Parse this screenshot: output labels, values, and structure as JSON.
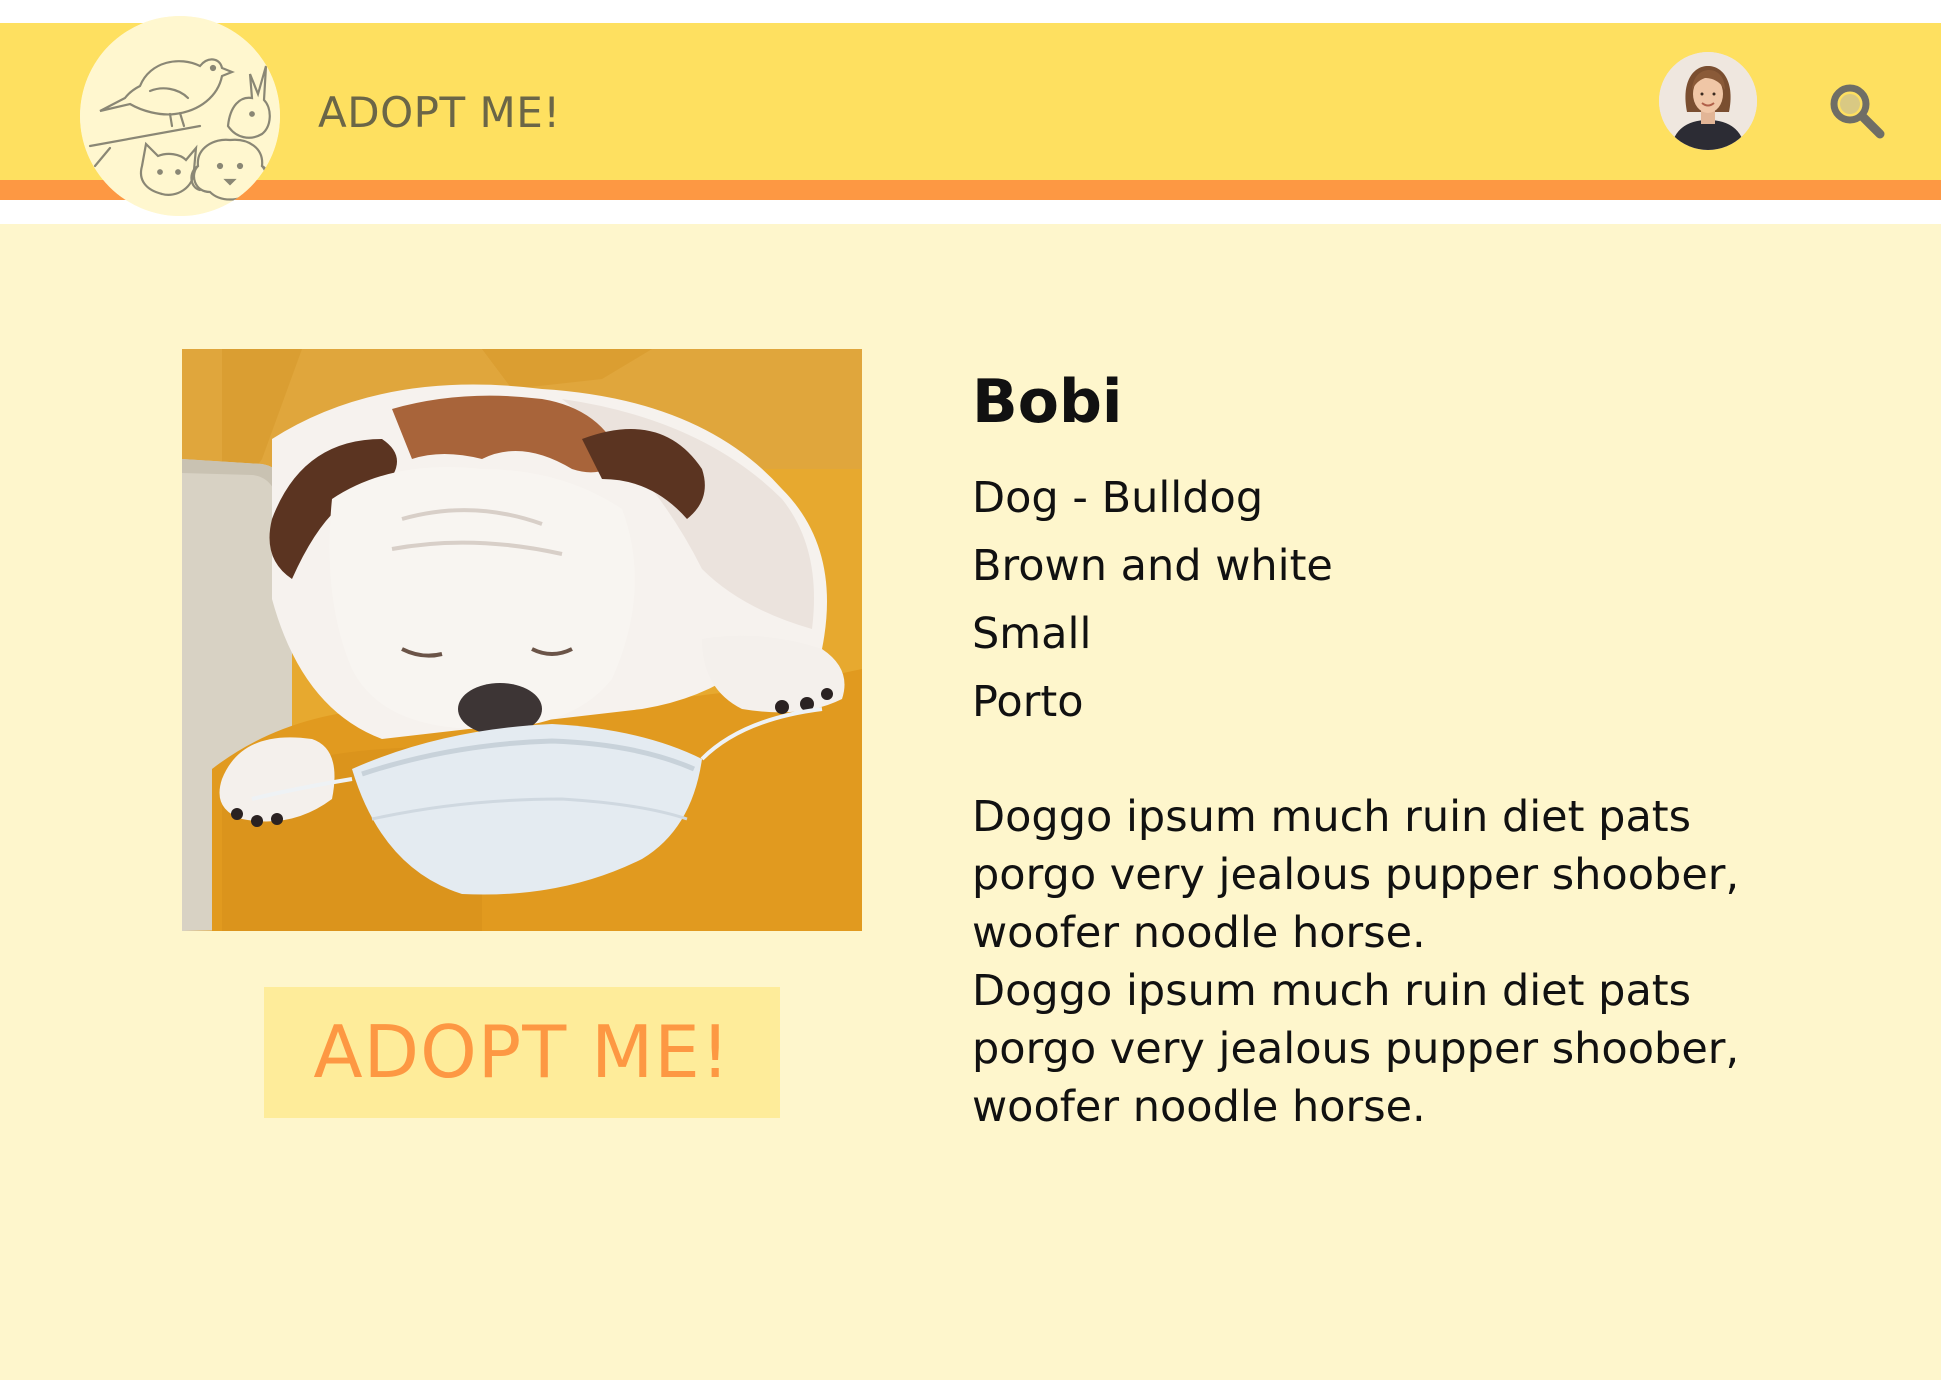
{
  "header": {
    "brand": "ADOPT ME!",
    "logo_icon": "pets-logo-icon",
    "avatar_icon": "user-avatar-icon",
    "search_icon": "search-icon",
    "colors": {
      "bar": "#fee060",
      "stripe": "#fd9843",
      "brand_text": "#6b6647"
    }
  },
  "pet": {
    "name": "Bobi",
    "attributes": [
      "Dog - Bulldog",
      "Brown and white",
      "Small",
      "Porto"
    ],
    "description": [
      "Doggo ipsum much ruin diet pats porgo very jealous pupper shoober, woofer noodle horse.",
      "Doggo ipsum much ruin diet pats porgo very jealous pupper shoober, woofer noodle horse."
    ]
  },
  "actions": {
    "adopt_label": "ADOPT ME!",
    "adopt_color": "#fd9843"
  },
  "page": {
    "background": "#fef6cc"
  }
}
